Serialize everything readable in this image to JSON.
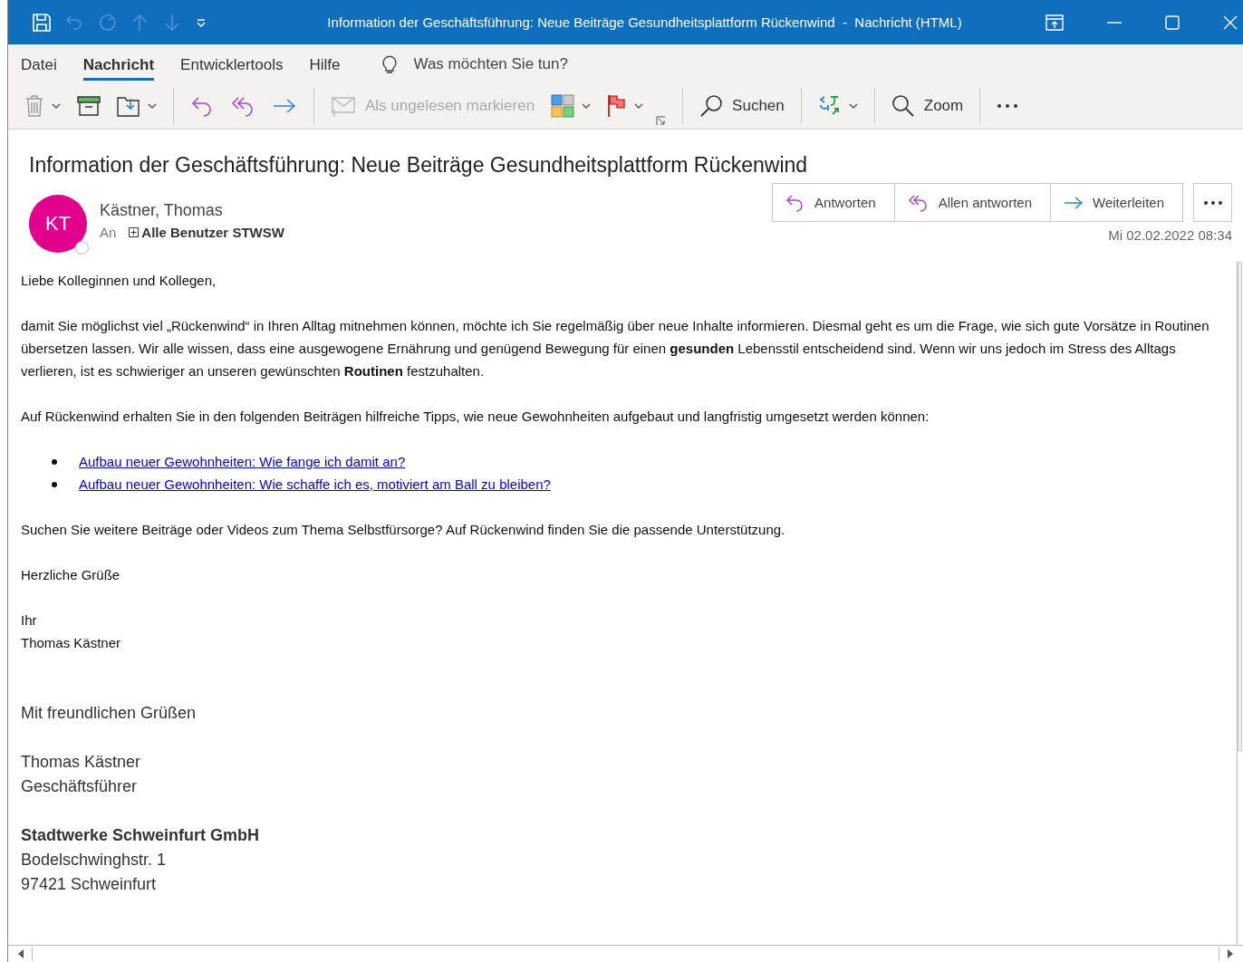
{
  "window": {
    "title": "Information der Geschäftsführung: Neue Beiträge Gesundheitsplattform Rückenwind  -  Nachricht (HTML)"
  },
  "tabs": [
    {
      "label": "Datei",
      "selected": false
    },
    {
      "label": "Nachricht",
      "selected": true
    },
    {
      "label": "Entwicklertools",
      "selected": false
    },
    {
      "label": "Hilfe",
      "selected": false
    }
  ],
  "tell_me": {
    "placeholder": "Was möchten Sie tun?"
  },
  "toolbar": {
    "mark_unread": {
      "label": "Als ungelesen markieren",
      "disabled": true
    },
    "search": {
      "label": "Suchen"
    },
    "zoom": {
      "label": "Zoom"
    }
  },
  "message": {
    "subject": "Information der Geschäftsführung: Neue Beiträge Gesundheitsplattform Rückenwind",
    "sender": {
      "initials": "KT",
      "name": "Kästner, Thomas",
      "color": "#e3008c"
    },
    "to_label": "An",
    "recipient": "Alle Benutzer STWSW",
    "actions": [
      {
        "kind": "reply",
        "label": "Antworten"
      },
      {
        "kind": "reply_all",
        "label": "Allen antworten"
      },
      {
        "kind": "forward",
        "label": "Weiterleiten"
      }
    ],
    "date": "Mi 02.02.2022 08:34"
  },
  "body": [
    {
      "kind": "p",
      "lines": [
        "Liebe Kolleginnen und Kollegen,"
      ]
    },
    {
      "kind": "p",
      "lines": [
        "damit Sie möglichst viel „Rückenwind“ in Ihren Alltag mitnehmen können, möchte ich Sie regelmäßig über neue Inhalte informieren. Diesmal geht es um die Frage, wie sich gute Vorsätze in Routinen übersetzen lassen. Wir alle wissen, dass eine ausgewogene Ernährung und genügend Bewegung für einen **gesunden** Lebensstil entscheidend sind. Wenn wir uns jedoch im Stress des Alltags verlieren, ist es schwieriger an unseren gewünschten **Routinen** festzuhalten."
      ]
    },
    {
      "kind": "p",
      "lines": [
        "Auf Rückenwind erhalten Sie in den folgenden Beiträgen hilfreiche Tipps, wie neue Gewohnheiten aufgebaut und langfristig umgesetzt werden können:"
      ]
    },
    {
      "kind": "links",
      "lines": [
        "Aufbau neuer Gewohnheiten: Wie fange ich damit an?",
        "Aufbau neuer Gewohnheiten: Wie schaffe ich es, motiviert am Ball zu bleiben?"
      ]
    },
    {
      "kind": "p",
      "lines": [
        "Suchen Sie weitere Beiträge oder Videos zum Thema Selbstfürsorge? Auf Rückenwind finden Sie die passende Unterstützung."
      ]
    },
    {
      "kind": "p",
      "lines": [
        "Herzliche Grüße"
      ]
    },
    {
      "kind": "p",
      "lines": [
        "Ihr",
        "Thomas Kästner"
      ]
    },
    {
      "kind": "signature",
      "lines": [
        "Mit freundlichen Grüßen"
      ]
    },
    {
      "kind": "signature",
      "lines": [
        "Thomas Kästner",
        "Geschäftsführer"
      ]
    },
    {
      "kind": "signature",
      "lines": [
        "**Stadtwerke Schweinfurt GmbH**",
        "Bodelschwinghstr. 1",
        "97421 Schweinfurt"
      ]
    }
  ]
}
